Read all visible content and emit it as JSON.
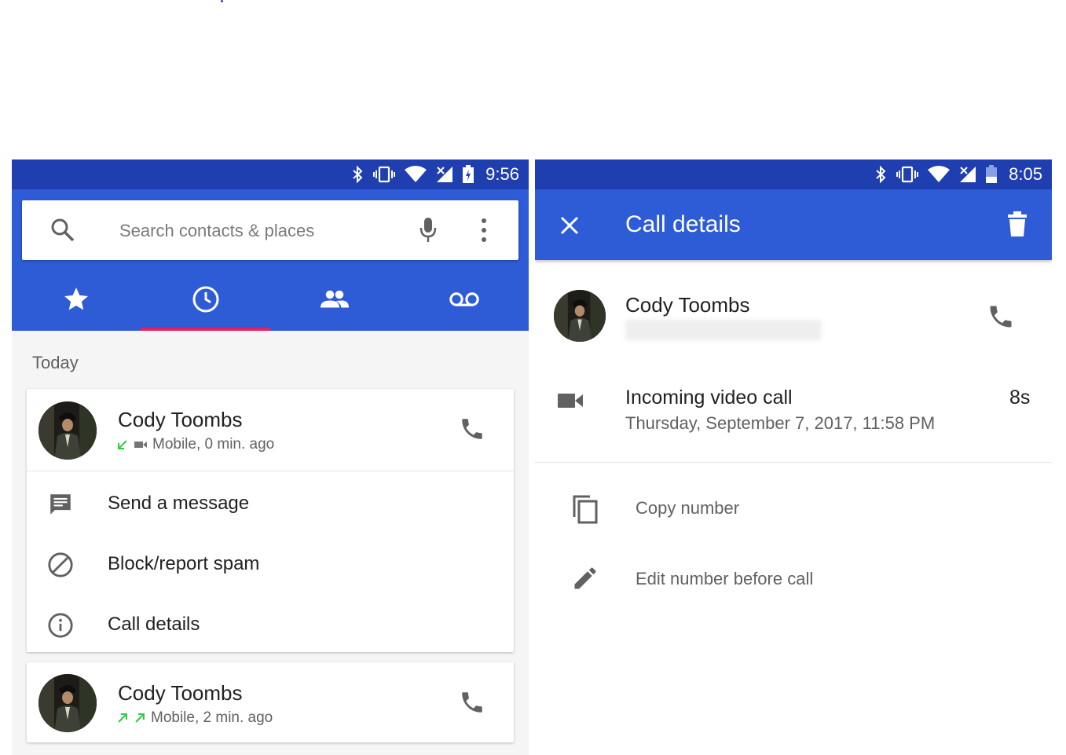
{
  "left_screen": {
    "status_bar": {
      "time": "9:56",
      "icons": [
        "bluetooth-icon",
        "vibrate-icon",
        "wifi-icon",
        "signal-icon",
        "battery-charging-icon"
      ]
    },
    "search": {
      "placeholder": "Search contacts & places"
    },
    "tabs": [
      {
        "name": "Favorites",
        "icon": "star-icon",
        "selected": false
      },
      {
        "name": "Recents",
        "icon": "clock-icon",
        "selected": true
      },
      {
        "name": "Contacts",
        "icon": "people-icon",
        "selected": false
      },
      {
        "name": "Voicemail",
        "icon": "voicemail-icon",
        "selected": false
      }
    ],
    "section_header": "Today",
    "entries": [
      {
        "name": "Cody Toombs",
        "detail": "Mobile, 0 min. ago",
        "indicators": [
          "incoming-arrow-icon",
          "video-icon"
        ],
        "expanded": true,
        "actions": [
          {
            "label": "Send a message",
            "icon": "message-icon"
          },
          {
            "label": "Block/report spam",
            "icon": "block-icon"
          },
          {
            "label": "Call details",
            "icon": "info-icon"
          }
        ]
      },
      {
        "name": "Cody Toombs",
        "detail": "Mobile, 2 min. ago",
        "indicators": [
          "outgoing-arrow-icon",
          "outgoing-arrow-icon"
        ],
        "expanded": false
      }
    ]
  },
  "right_screen": {
    "status_bar": {
      "time": "8:05",
      "icons": [
        "bluetooth-icon",
        "vibrate-icon",
        "wifi-icon",
        "signal-icon",
        "battery-icon"
      ]
    },
    "app_bar": {
      "title": "Call details"
    },
    "contact": {
      "name": "Cody Toombs"
    },
    "history": {
      "type": "Incoming video call",
      "date": "Thursday, September 7, 2017, 11:58 PM",
      "duration": "8s"
    },
    "actions": [
      {
        "label": "Copy number",
        "icon": "copy-icon"
      },
      {
        "label": "Edit number before call",
        "icon": "pencil-icon"
      }
    ]
  },
  "colors": {
    "status_bar": "#1f3fb0",
    "primary": "#2e5bd6",
    "tab_indicator": "#e91e63",
    "call_arrow": "#2ecc40"
  }
}
